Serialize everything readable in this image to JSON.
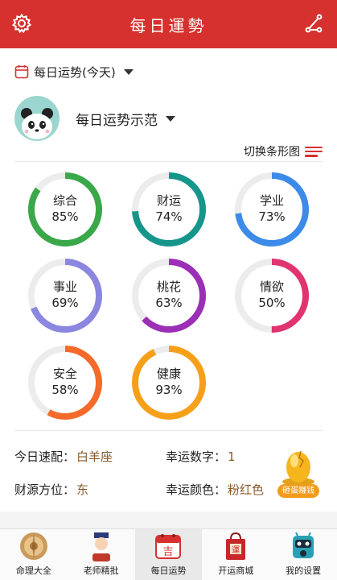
{
  "header": {
    "title": "每日運勢"
  },
  "date_selector": {
    "label": "每日运势(今天)"
  },
  "profile": {
    "name": "每日运势示范"
  },
  "switch_view": {
    "label": "切换条形图"
  },
  "fortunes": [
    {
      "name": "综合",
      "percent_text": "85%",
      "value": 85,
      "color": "#3aa84a"
    },
    {
      "name": "财运",
      "percent_text": "74%",
      "value": 74,
      "color": "#16968a"
    },
    {
      "name": "学业",
      "percent_text": "73%",
      "value": 73,
      "color": "#3d8be8"
    },
    {
      "name": "事业",
      "percent_text": "69%",
      "value": 69,
      "color": "#8b86df"
    },
    {
      "name": "桃花",
      "percent_text": "63%",
      "value": 63,
      "color": "#9b2fb6"
    },
    {
      "name": "情欲",
      "percent_text": "50%",
      "value": 50,
      "color": "#e0336f"
    },
    {
      "name": "安全",
      "percent_text": "58%",
      "value": 58,
      "color": "#f46a2a"
    },
    {
      "name": "健康",
      "percent_text": "93%",
      "value": 93,
      "color": "#f6a01a"
    }
  ],
  "info": {
    "pairing_label": "今日速配：",
    "pairing_value": "白羊座",
    "lucky_number_label": "幸运数字：",
    "lucky_number_value": "1",
    "wealth_dir_label": "财源方位：",
    "wealth_dir_value": "东",
    "lucky_color_label": "幸运颜色：",
    "lucky_color_value": "粉红色"
  },
  "egg_button": {
    "label": "砸蛋赚钱"
  },
  "tabs": [
    {
      "label": "命理大全",
      "icon": "compass-icon"
    },
    {
      "label": "老师精批",
      "icon": "teacher-icon"
    },
    {
      "label": "每日运势",
      "icon": "calendar-icon",
      "active": true
    },
    {
      "label": "开运商城",
      "icon": "shop-bag-icon"
    },
    {
      "label": "我的设置",
      "icon": "robot-icon"
    }
  ],
  "colors": {
    "brand_red": "#d6312e",
    "value_brown": "#8b5a2b",
    "ring_track": "#ececec"
  }
}
